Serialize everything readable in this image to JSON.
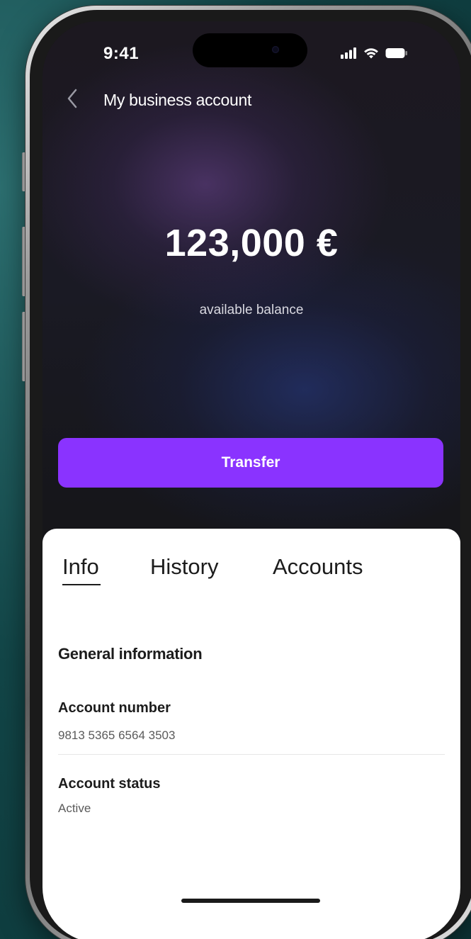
{
  "status_bar": {
    "time": "9:41",
    "icons": [
      "signal-icon",
      "wifi-icon",
      "battery-icon"
    ]
  },
  "header": {
    "back_icon": "chevron-left-icon",
    "title": "My business account"
  },
  "balance": {
    "amount": "123,000 €",
    "label": "available balance"
  },
  "actions": {
    "transfer_label": "Transfer"
  },
  "tabs": [
    {
      "label": "Info",
      "active": true
    },
    {
      "label": "History",
      "active": false
    },
    {
      "label": "Accounts",
      "active": false
    }
  ],
  "info": {
    "section_title": "General information",
    "fields": [
      {
        "label": "Account number",
        "value": "9813 5365 6564 3503"
      },
      {
        "label": "Account status",
        "value": "Active"
      }
    ]
  },
  "colors": {
    "accent": "#8a33ff",
    "background": "#124648",
    "sheet": "#ffffff"
  }
}
